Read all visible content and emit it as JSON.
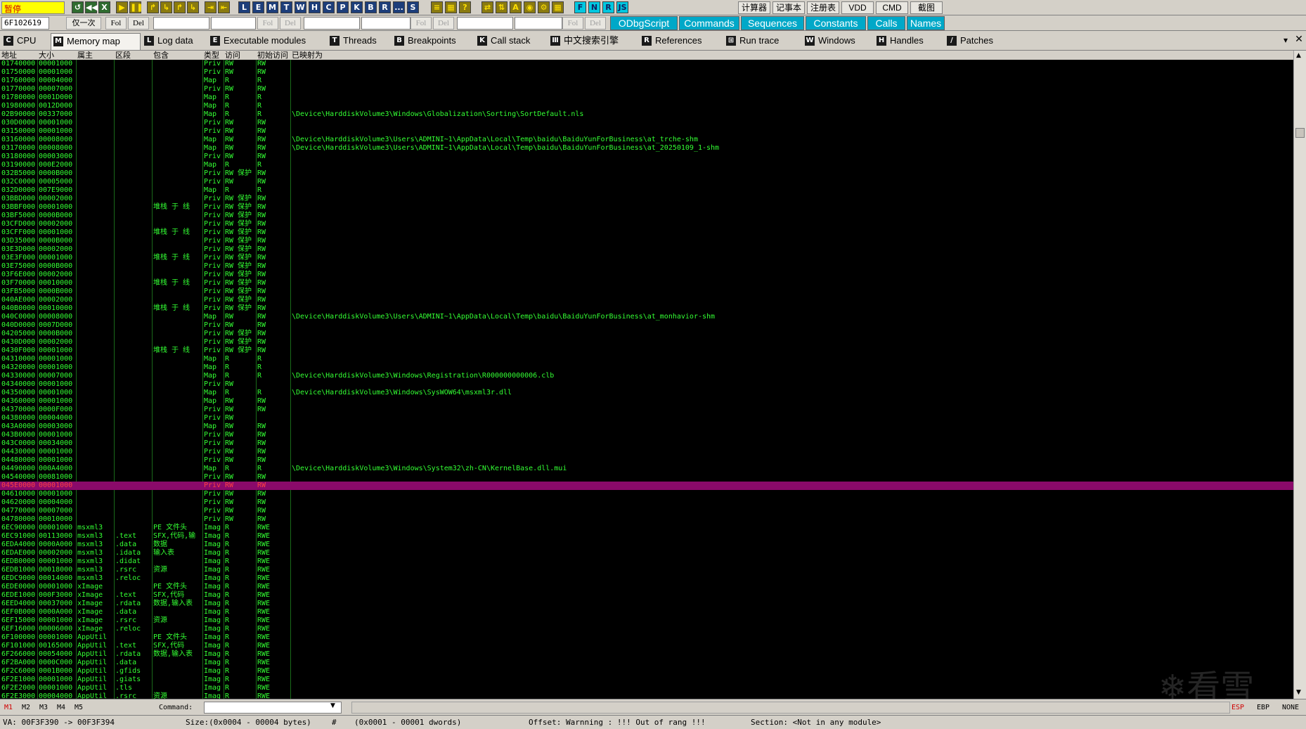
{
  "toolbar": {
    "status": "暂停",
    "run_buttons": [
      "↺",
      "◀◀",
      "X",
      "▶",
      "❚❚",
      "↱",
      "↳",
      "↱",
      "↳",
      "⇥",
      "⇤"
    ],
    "view_buttons": [
      "L",
      "E",
      "M",
      "T",
      "W",
      "H",
      "C",
      "P",
      "K",
      "B",
      "R",
      "...",
      "S"
    ],
    "misc_buttons": [
      "≡",
      "▦",
      "?",
      "⇄",
      "⇅",
      "A",
      "◉",
      "⚙",
      "▦",
      "F",
      "N",
      "R",
      "JS"
    ],
    "tools": [
      "计算器",
      "记事本",
      "注册表",
      "VDD",
      "CMD",
      "截图"
    ]
  },
  "toolbar2": {
    "address": "6F102619",
    "once": "仅一次",
    "fol": "Fol",
    "del": "Del",
    "plugins": [
      "ODbgScript",
      "Commands",
      "Sequences",
      "Constants",
      "Calls",
      "Names"
    ]
  },
  "tabs": [
    {
      "key": "C",
      "label": "CPU"
    },
    {
      "key": "M",
      "label": "Memory map"
    },
    {
      "key": "L",
      "label": "Log data"
    },
    {
      "key": "E",
      "label": "Executable modules"
    },
    {
      "key": "T",
      "label": "Threads"
    },
    {
      "key": "B",
      "label": "Breakpoints"
    },
    {
      "key": "K",
      "label": "Call stack"
    },
    {
      "key": "Ⅲ",
      "label": "中文搜索引擎"
    },
    {
      "key": "R",
      "label": "References"
    },
    {
      "key": "⊞",
      "label": "Run trace"
    },
    {
      "key": "W",
      "label": "Windows"
    },
    {
      "key": "H",
      "label": "Handles"
    },
    {
      "key": "/",
      "label": "Patches"
    }
  ],
  "columns": [
    "地址",
    "大小",
    "属主",
    "区段",
    "包含",
    "类型",
    "访问",
    "初始访问",
    "已映射为"
  ],
  "rows": [
    [
      "01740000",
      "00001000",
      "",
      "",
      "",
      "Priv",
      "RW",
      "RW",
      ""
    ],
    [
      "01750000",
      "00001000",
      "",
      "",
      "",
      "Priv",
      "RW",
      "RW",
      ""
    ],
    [
      "01760000",
      "00004000",
      "",
      "",
      "",
      "Map",
      "R",
      "R",
      ""
    ],
    [
      "01770000",
      "00007000",
      "",
      "",
      "",
      "Priv",
      "RW",
      "RW",
      ""
    ],
    [
      "01780000",
      "0001D000",
      "",
      "",
      "",
      "Map",
      "R",
      "R",
      ""
    ],
    [
      "01980000",
      "0012D000",
      "",
      "",
      "",
      "Map",
      "R",
      "R",
      ""
    ],
    [
      "02B90000",
      "00337000",
      "",
      "",
      "",
      "Map",
      "R",
      "R",
      "\\Device\\HarddiskVolume3\\Windows\\Globalization\\Sorting\\SortDefault.nls"
    ],
    [
      "030D0000",
      "00001000",
      "",
      "",
      "",
      "Priv",
      "RW",
      "RW",
      ""
    ],
    [
      "03150000",
      "00001000",
      "",
      "",
      "",
      "Priv",
      "RW",
      "RW",
      ""
    ],
    [
      "03160000",
      "00008000",
      "",
      "",
      "",
      "Map",
      "RW",
      "RW",
      "\\Device\\HarddiskVolume3\\Users\\ADMINI~1\\AppData\\Local\\Temp\\baidu\\BaiduYunForBusiness\\at_trche-shm"
    ],
    [
      "03170000",
      "00008000",
      "",
      "",
      "",
      "Map",
      "RW",
      "RW",
      "\\Device\\HarddiskVolume3\\Users\\ADMINI~1\\AppData\\Local\\Temp\\baidu\\BaiduYunForBusiness\\at_20250109_1-shm"
    ],
    [
      "03180000",
      "00003000",
      "",
      "",
      "",
      "Priv",
      "RW",
      "RW",
      ""
    ],
    [
      "03190000",
      "000E2000",
      "",
      "",
      "",
      "Map",
      "R",
      "R",
      ""
    ],
    [
      "032B5000",
      "0000B000",
      "",
      "",
      "",
      "Priv",
      "RW  保护",
      "RW",
      ""
    ],
    [
      "032C0000",
      "00005000",
      "",
      "",
      "",
      "Priv",
      "RW",
      "RW",
      ""
    ],
    [
      "032D0000",
      "007E9000",
      "",
      "",
      "",
      "Map",
      "R",
      "R",
      ""
    ],
    [
      "03BBD000",
      "00002000",
      "",
      "",
      "",
      "Priv",
      "RW  保护",
      "RW",
      ""
    ],
    [
      "03BBF000",
      "00001000",
      "",
      "",
      "堆栈 于 线",
      "Priv",
      "RW  保护",
      "RW",
      ""
    ],
    [
      "03BF5000",
      "0000B000",
      "",
      "",
      "",
      "Priv",
      "RW  保护",
      "RW",
      ""
    ],
    [
      "03CFD000",
      "00002000",
      "",
      "",
      "",
      "Priv",
      "RW  保护",
      "RW",
      ""
    ],
    [
      "03CFF000",
      "00001000",
      "",
      "",
      "堆栈 于 线",
      "Priv",
      "RW  保护",
      "RW",
      ""
    ],
    [
      "03D35000",
      "0000B000",
      "",
      "",
      "",
      "Priv",
      "RW  保护",
      "RW",
      ""
    ],
    [
      "03E3D000",
      "00002000",
      "",
      "",
      "",
      "Priv",
      "RW  保护",
      "RW",
      ""
    ],
    [
      "03E3F000",
      "00001000",
      "",
      "",
      "堆栈 于 线",
      "Priv",
      "RW  保护",
      "RW",
      ""
    ],
    [
      "03E75000",
      "0000B000",
      "",
      "",
      "",
      "Priv",
      "RW  保护",
      "RW",
      ""
    ],
    [
      "03F6E000",
      "00002000",
      "",
      "",
      "",
      "Priv",
      "RW  保护",
      "RW",
      ""
    ],
    [
      "03F70000",
      "00010000",
      "",
      "",
      "堆栈 于 线",
      "Priv",
      "RW  保护",
      "RW",
      ""
    ],
    [
      "03FB5000",
      "0000B000",
      "",
      "",
      "",
      "Priv",
      "RW  保护",
      "RW",
      ""
    ],
    [
      "040AE000",
      "00002000",
      "",
      "",
      "",
      "Priv",
      "RW  保护",
      "RW",
      ""
    ],
    [
      "040B0000",
      "00010000",
      "",
      "",
      "堆栈 于 线",
      "Priv",
      "RW  保护",
      "RW",
      ""
    ],
    [
      "040C0000",
      "00008000",
      "",
      "",
      "",
      "Map",
      "RW",
      "RW",
      "\\Device\\HarddiskVolume3\\Users\\ADMINI~1\\AppData\\Local\\Temp\\baidu\\BaiduYunForBusiness\\at_monhavior-shm"
    ],
    [
      "040D0000",
      "0007D000",
      "",
      "",
      "",
      "Priv",
      "RW",
      "RW",
      ""
    ],
    [
      "04205000",
      "0000B000",
      "",
      "",
      "",
      "Priv",
      "RW  保护",
      "RW",
      ""
    ],
    [
      "0430D000",
      "00002000",
      "",
      "",
      "",
      "Priv",
      "RW  保护",
      "RW",
      ""
    ],
    [
      "0430F000",
      "00001000",
      "",
      "",
      "堆栈 于 线",
      "Priv",
      "RW  保护",
      "RW",
      ""
    ],
    [
      "04310000",
      "00001000",
      "",
      "",
      "",
      "Map",
      "R",
      "R",
      ""
    ],
    [
      "04320000",
      "00001000",
      "",
      "",
      "",
      "Map",
      "R",
      "R",
      ""
    ],
    [
      "04330000",
      "00007000",
      "",
      "",
      "",
      "Map",
      "R",
      "R",
      "\\Device\\HarddiskVolume3\\Windows\\Registration\\R000000000006.clb"
    ],
    [
      "04340000",
      "00001000",
      "",
      "",
      "",
      "Priv",
      "RW",
      "",
      ""
    ],
    [
      "04350000",
      "00001000",
      "",
      "",
      "",
      "Map",
      "R",
      "R",
      "\\Device\\HarddiskVolume3\\Windows\\SysWOW64\\msxml3r.dll"
    ],
    [
      "04360000",
      "00001000",
      "",
      "",
      "",
      "Map",
      "RW",
      "RW",
      ""
    ],
    [
      "04370000",
      "0000F000",
      "",
      "",
      "",
      "Priv",
      "RW",
      "RW",
      ""
    ],
    [
      "04380000",
      "00004000",
      "",
      "",
      "",
      "Priv",
      "RW",
      "",
      ""
    ],
    [
      "043A0000",
      "00003000",
      "",
      "",
      "",
      "Map",
      "RW",
      "RW",
      ""
    ],
    [
      "043B0000",
      "00001000",
      "",
      "",
      "",
      "Priv",
      "RW",
      "RW",
      ""
    ],
    [
      "043C0000",
      "00034000",
      "",
      "",
      "",
      "Priv",
      "RW",
      "RW",
      ""
    ],
    [
      "04430000",
      "00001000",
      "",
      "",
      "",
      "Priv",
      "RW",
      "RW",
      ""
    ],
    [
      "04480000",
      "00001000",
      "",
      "",
      "",
      "Priv",
      "RW",
      "RW",
      ""
    ],
    [
      "04490000",
      "000A4000",
      "",
      "",
      "",
      "Map",
      "R",
      "R",
      "\\Device\\HarddiskVolume3\\Windows\\System32\\zh-CN\\KernelBase.dll.mui"
    ],
    [
      "04540000",
      "00081000",
      "",
      "",
      "",
      "Priv",
      "RW",
      "RW",
      ""
    ],
    [
      "045E0000",
      "00001000",
      "",
      "",
      "",
      "Priv",
      "RW",
      "RW",
      ""
    ],
    [
      "04610000",
      "00001000",
      "",
      "",
      "",
      "Priv",
      "RW",
      "RW",
      ""
    ],
    [
      "04620000",
      "00004000",
      "",
      "",
      "",
      "Priv",
      "RW",
      "RW",
      ""
    ],
    [
      "04770000",
      "00007000",
      "",
      "",
      "",
      "Priv",
      "RW",
      "RW",
      ""
    ],
    [
      "04780000",
      "00010000",
      "",
      "",
      "",
      "Priv",
      "RW",
      "RW",
      ""
    ],
    [
      "6EC90000",
      "00001000",
      "msxml3",
      "",
      "PE 文件头",
      "Imag",
      "R",
      "RWE",
      ""
    ],
    [
      "6EC91000",
      "00113000",
      "msxml3",
      ".text",
      "SFX,代码,输",
      "Imag",
      "R",
      "RWE",
      ""
    ],
    [
      "6EDA4000",
      "0000A000",
      "msxml3",
      ".data",
      "数据",
      "Imag",
      "R",
      "RWE",
      ""
    ],
    [
      "6EDAE000",
      "00002000",
      "msxml3",
      ".idata",
      "输入表",
      "Imag",
      "R",
      "RWE",
      ""
    ],
    [
      "6EDB0000",
      "00001000",
      "msxml3",
      ".didat",
      "",
      "Imag",
      "R",
      "RWE",
      ""
    ],
    [
      "6EDB1000",
      "00018000",
      "msxml3",
      ".rsrc",
      "资源",
      "Imag",
      "R",
      "RWE",
      ""
    ],
    [
      "6EDC9000",
      "00014000",
      "msxml3",
      ".reloc",
      "",
      "Imag",
      "R",
      "RWE",
      ""
    ],
    [
      "6EDE0000",
      "00001000",
      "xImage",
      "",
      "PE 文件头",
      "Imag",
      "R",
      "RWE",
      ""
    ],
    [
      "6EDE1000",
      "000F3000",
      "xImage",
      ".text",
      "SFX,代码",
      "Imag",
      "R",
      "RWE",
      ""
    ],
    [
      "6EED4000",
      "00037000",
      "xImage",
      ".rdata",
      "数据,输入表",
      "Imag",
      "R",
      "RWE",
      ""
    ],
    [
      "6EF0B000",
      "0000A000",
      "xImage",
      ".data",
      "",
      "Imag",
      "R",
      "RWE",
      ""
    ],
    [
      "6EF15000",
      "00001000",
      "xImage",
      ".rsrc",
      "资源",
      "Imag",
      "R",
      "RWE",
      ""
    ],
    [
      "6EF16000",
      "00006000",
      "xImage",
      ".reloc",
      "",
      "Imag",
      "R",
      "RWE",
      ""
    ],
    [
      "6F100000",
      "00001000",
      "AppUtil",
      "",
      "PE 文件头",
      "Imag",
      "R",
      "RWE",
      ""
    ],
    [
      "6F101000",
      "00165000",
      "AppUtil",
      ".text",
      "SFX,代码",
      "Imag",
      "R",
      "RWE",
      ""
    ],
    [
      "6F266000",
      "00054000",
      "AppUtil",
      ".rdata",
      "数据,输入表",
      "Imag",
      "R",
      "RWE",
      ""
    ],
    [
      "6F2BA000",
      "0000C000",
      "AppUtil",
      ".data",
      "",
      "Imag",
      "R",
      "RWE",
      ""
    ],
    [
      "6F2C6000",
      "0001B000",
      "AppUtil",
      ".gfids",
      "",
      "Imag",
      "R",
      "RWE",
      ""
    ],
    [
      "6F2E1000",
      "00001000",
      "AppUtil",
      ".giats",
      "",
      "Imag",
      "R",
      "RWE",
      ""
    ],
    [
      "6F2E2000",
      "00001000",
      "AppUtil",
      ".tls",
      "",
      "Imag",
      "R",
      "RWE",
      ""
    ],
    [
      "6F2E3000",
      "00004000",
      "AppUtil",
      ".rsrc",
      "资源",
      "Imag",
      "R",
      "RWE",
      ""
    ]
  ],
  "selected_row": 50,
  "command": {
    "markers": [
      "M1",
      "M2",
      "M3",
      "M4",
      "M5"
    ],
    "label": "Command:",
    "regs": [
      "ESP",
      "EBP",
      "NONE"
    ]
  },
  "status": {
    "va": "VA: 00F3F390 -> 00F3F394",
    "size": "Size:(0x0004 - 00004 bytes)",
    "hash": "#",
    "dwords": "(0x0001 - 00001 dwords)",
    "offset": "Offset: Warnning : !!! Out of rang !!!",
    "section": "Section: <Not in any module>"
  },
  "watermark": "看雪"
}
